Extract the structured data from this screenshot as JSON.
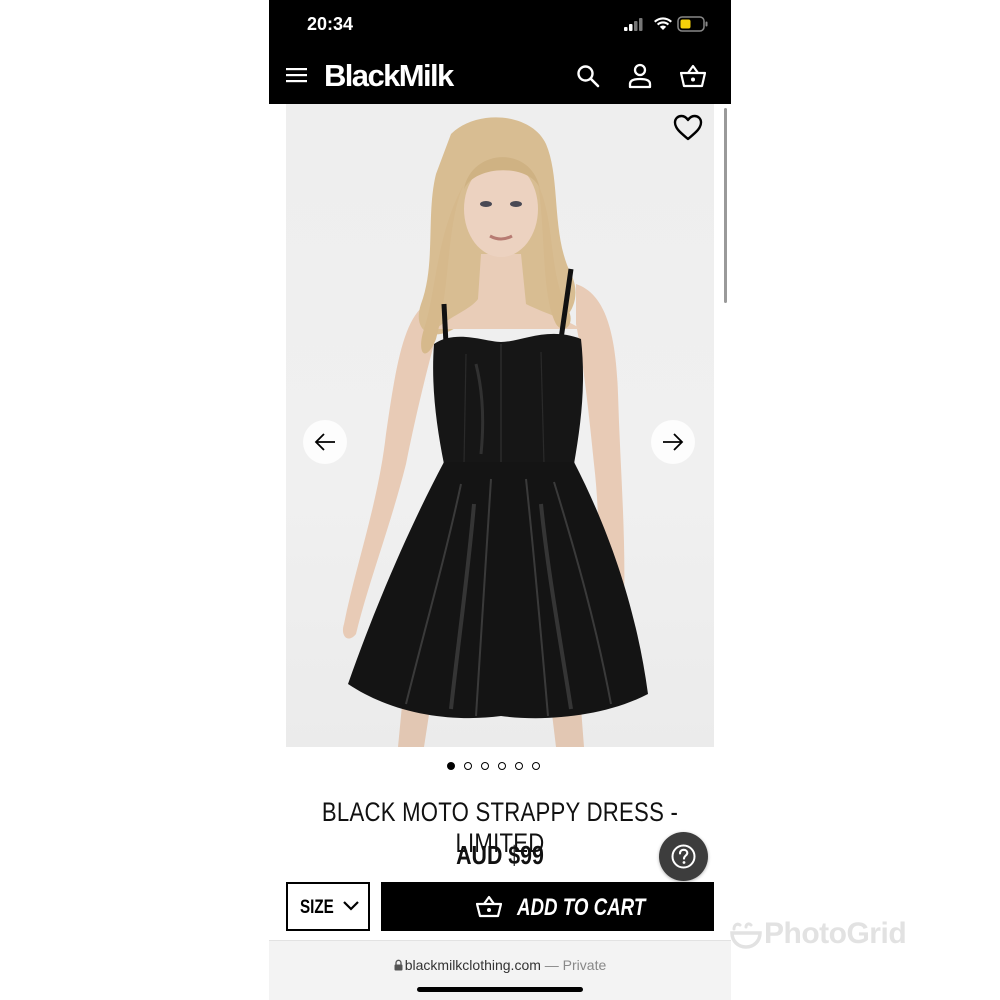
{
  "status_bar": {
    "time": "20:34"
  },
  "header": {
    "brand": "BlackMilk",
    "icons": [
      "menu-icon",
      "search-icon",
      "account-icon",
      "basket-icon"
    ]
  },
  "product": {
    "title": "BLACK MOTO STRAPPY DRESS - LIMITED",
    "price": "AUD $99",
    "image_count": 6,
    "active_image": 1,
    "image_description_icon": "product-photo"
  },
  "actions": {
    "size_label": "SIZE",
    "add_to_cart_label": "ADD TO CART"
  },
  "browser": {
    "domain": "blackmilkclothing.com",
    "privacy": " — Private"
  },
  "watermark": {
    "text": "PhotoGrid"
  },
  "colors": {
    "header_bg": "#000000",
    "accent": "#000000",
    "battery": "#f5d10a",
    "help_bg": "#3d3d3d"
  }
}
